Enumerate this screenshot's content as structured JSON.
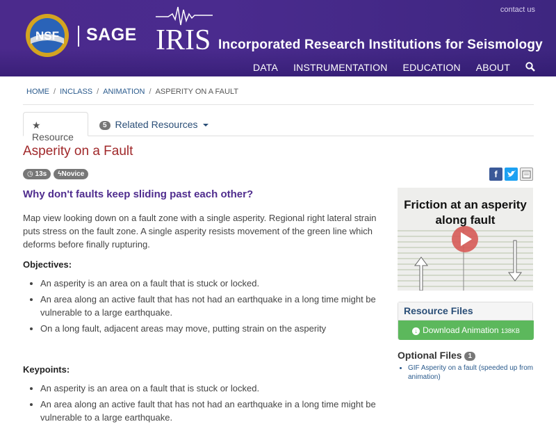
{
  "header": {
    "contact": "contact us",
    "sage": "SAGE",
    "iris_wordmark": "IRIS",
    "org_name": "Incorporated Research Institutions for Seismology",
    "nav": [
      "DATA",
      "INSTRUMENTATION",
      "EDUCATION",
      "ABOUT"
    ]
  },
  "breadcrumb": [
    "HOME",
    "INCLASS",
    "ANIMATION",
    "ASPERITY ON A FAULT"
  ],
  "tabs": {
    "resource": "Resource",
    "related_count": "5",
    "related": "Related Resources"
  },
  "page": {
    "title": "Asperity on a Fault",
    "labels": [
      "13s",
      "Novice"
    ],
    "question": "Why don't faults keep sliding past each other?",
    "description": "Map view looking down on a fault zone with a single asperity. Regional right lateral strain puts stress on the fault zone. A single asperity resists movement of the green line which deforms before finally rupturing.",
    "objectives_heading": "Objectives:",
    "objectives": [
      "An asperity is an area on a fault that is stuck or locked.",
      "An area along an active fault that has not had an earthquake in a long time might be vulnerable to a large earthquake.",
      "On a long fault, adjacent areas may move, putting strain on the asperity"
    ],
    "keypoints_heading": "Keypoints:",
    "keypoints": [
      "An asperity is an area on a fault that is stuck or locked.",
      "An area along an active fault that has not had an earthquake in a long time might be vulnerable to a large earthquake."
    ]
  },
  "sidebar": {
    "thumb_title": "Friction at an asperity along fault",
    "resource_files": "Resource Files",
    "download_label": "Download Animation",
    "download_size": "138KB",
    "optional_heading": "Optional Files",
    "optional_count": "1",
    "optional_items": [
      "GIF Asperity on a fault (speeded up from animation)"
    ]
  },
  "colors": {
    "header_purple": "#4b2a8c",
    "title_red": "#a0282a",
    "question_purple": "#4f2c8e",
    "download_green": "#5cb85c"
  }
}
